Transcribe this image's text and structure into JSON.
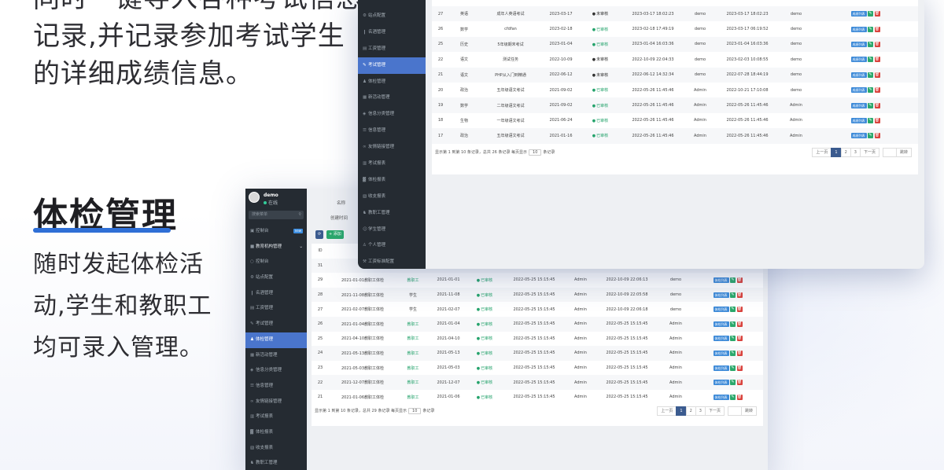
{
  "marketing": {
    "top_lines": [
      "同时一键导入各种考试信息",
      "记录,并记录参加考试学生",
      "的详细成绩信息。"
    ],
    "section_title": "体检管理",
    "section_lines": [
      "随时发起体检活",
      "动,学生和教职工",
      "均可录入管理。"
    ]
  },
  "accent_color": "#2f6fd6",
  "back_window": {
    "user": {
      "name": "demo",
      "status": "在线"
    },
    "search_placeholder": "搜索菜单",
    "nav": [
      {
        "label": "控制台",
        "icon": "dashboard-icon",
        "badge": "new",
        "group": false,
        "active": false
      },
      {
        "label": "教育机构管理",
        "icon": "folder-icon",
        "group": true,
        "active": false
      },
      {
        "label": "控制台",
        "icon": "circle-icon",
        "active": false
      },
      {
        "label": "站点配置",
        "icon": "gear-icon",
        "active": false
      },
      {
        "label": "名酒管理",
        "icon": "bottle-icon",
        "active": false
      },
      {
        "label": "工资管理",
        "icon": "doc-icon",
        "active": false
      },
      {
        "label": "考试管理",
        "icon": "edit-icon",
        "active": false
      },
      {
        "label": "体检管理",
        "icon": "user-icon",
        "active": true
      },
      {
        "label": "新活动管理",
        "icon": "grid-icon",
        "active": false
      },
      {
        "label": "信息分类管理",
        "icon": "tag-icon",
        "active": false
      },
      {
        "label": "信息管理",
        "icon": "list-icon",
        "active": false
      },
      {
        "label": "友情链接管理",
        "icon": "link-icon",
        "active": false
      },
      {
        "label": "考试报表",
        "icon": "table-icon",
        "active": false
      },
      {
        "label": "体检报表",
        "icon": "chart-icon",
        "active": false
      },
      {
        "label": "收支报表",
        "icon": "wallet-icon",
        "active": false
      },
      {
        "label": "教职工管理",
        "icon": "team-icon",
        "active": false
      }
    ],
    "filters": {
      "name_label": "名称",
      "created_label": "创建时间"
    },
    "toolbar": {
      "refresh": "⟳",
      "add": "+ 添加"
    },
    "header_id": "ID",
    "rows": [
      {
        "id": "31",
        "name": "",
        "type": "",
        "date": "",
        "status": "",
        "created": "",
        "creator": "",
        "updated": "",
        "editor": ""
      },
      {
        "id": "29",
        "name": "2021-01-01教职工体检",
        "type": "教职工",
        "type_teacher": true,
        "date": "2021-01-01",
        "status": "已审核",
        "created": "2022-05-25 15:15:45",
        "creator": "Admin",
        "updated": "2022-10-09 22:06:13",
        "editor": "demo"
      },
      {
        "id": "28",
        "name": "2021-11-08教职工体检",
        "type": "学生",
        "type_teacher": false,
        "date": "2021-11-08",
        "status": "已审核",
        "created": "2022-05-25 15:15:45",
        "creator": "Admin",
        "updated": "2022-10-09 22:05:58",
        "editor": "demo"
      },
      {
        "id": "27",
        "name": "2021-02-07教职工体检",
        "type": "学生",
        "type_teacher": false,
        "date": "2021-02-07",
        "status": "已审核",
        "created": "2022-05-25 15:15:45",
        "creator": "Admin",
        "updated": "2022-10-09 22:06:18",
        "editor": "demo"
      },
      {
        "id": "26",
        "name": "2021-01-04教职工体检",
        "type": "教职工",
        "type_teacher": true,
        "date": "2021-01-04",
        "status": "已审核",
        "created": "2022-05-25 15:15:45",
        "creator": "Admin",
        "updated": "2022-05-25 15:15:45",
        "editor": "Admin"
      },
      {
        "id": "25",
        "name": "2021-04-10教职工体检",
        "type": "教职工",
        "type_teacher": true,
        "date": "2021-04-10",
        "status": "已审核",
        "created": "2022-05-25 15:15:45",
        "creator": "Admin",
        "updated": "2022-05-25 15:15:45",
        "editor": "Admin"
      },
      {
        "id": "24",
        "name": "2021-05-13教职工体检",
        "type": "教职工",
        "type_teacher": true,
        "date": "2021-05-13",
        "status": "已审核",
        "created": "2022-05-25 15:15:45",
        "creator": "Admin",
        "updated": "2022-05-25 15:15:45",
        "editor": "Admin"
      },
      {
        "id": "23",
        "name": "2021-05-03教职工体检",
        "type": "教职工",
        "type_teacher": true,
        "date": "2021-05-03",
        "status": "已审核",
        "created": "2022-05-25 15:15:45",
        "creator": "Admin",
        "updated": "2022-05-25 15:15:45",
        "editor": "Admin"
      },
      {
        "id": "22",
        "name": "2021-12-07教职工体检",
        "type": "教职工",
        "type_teacher": true,
        "date": "2021-12-07",
        "status": "已审核",
        "created": "2022-05-25 15:15:45",
        "creator": "Admin",
        "updated": "2022-05-25 15:15:45",
        "editor": "Admin"
      },
      {
        "id": "21",
        "name": "2021-01-06教职工体检",
        "type": "教职工",
        "type_teacher": true,
        "date": "2021-01-06",
        "status": "已审核",
        "created": "2022-05-25 15:15:45",
        "creator": "Admin",
        "updated": "2022-05-25 15:15:45",
        "editor": "Admin"
      }
    ],
    "row_buttons": {
      "list": "体检列表",
      "edit": "✎",
      "del": "🗑"
    },
    "pager_info": {
      "prefix": "显示第 1 到第 10 条记录，总共 29 条记录 每页显示",
      "size": "10",
      "suffix": "条记录"
    },
    "pager": {
      "prev": "上一页",
      "pages": [
        "1",
        "2",
        "3"
      ],
      "next": "下一页",
      "jump": "跳转"
    }
  },
  "front_window": {
    "nav": [
      {
        "label": "站点配置",
        "icon": "gear-icon",
        "active": false
      },
      {
        "label": "名酒管理",
        "icon": "bottle-icon",
        "active": false
      },
      {
        "label": "工资管理",
        "icon": "doc-icon",
        "active": false
      },
      {
        "label": "考试管理",
        "icon": "edit-icon",
        "active": true
      },
      {
        "label": "体检管理",
        "icon": "user-icon",
        "active": false
      },
      {
        "label": "新活动管理",
        "icon": "grid-icon",
        "active": false
      },
      {
        "label": "信息分类管理",
        "icon": "tag-icon",
        "active": false
      },
      {
        "label": "信息管理",
        "icon": "list-icon",
        "active": false
      },
      {
        "label": "友情链接管理",
        "icon": "link-icon",
        "active": false
      },
      {
        "label": "考试报表",
        "icon": "table-icon",
        "active": false
      },
      {
        "label": "体检报表",
        "icon": "chart-icon",
        "active": false
      },
      {
        "label": "收支报表",
        "icon": "wallet-icon",
        "active": false
      },
      {
        "label": "教职工管理",
        "icon": "team-icon",
        "active": false
      },
      {
        "label": "学生管理",
        "icon": "student-icon",
        "active": false
      },
      {
        "label": "个人管理",
        "icon": "person-icon",
        "active": false
      },
      {
        "label": "工资标准配置",
        "icon": "settings-icon",
        "active": false
      }
    ],
    "rows": [
      {
        "id": "27",
        "subject": "英语",
        "name": "成年人英语考试",
        "date": "2023-03-17",
        "status": "未审核",
        "approved": false,
        "created": "2023-03-17 18:02:23",
        "creator": "demo",
        "updated": "2023-03-17 18:02:23",
        "editor": "demo"
      },
      {
        "id": "26",
        "subject": "数学",
        "name": "cfdfan",
        "date": "2023-02-18",
        "status": "已审核",
        "approved": true,
        "created": "2023-02-18 17:49:19",
        "creator": "demo",
        "updated": "2023-03-17 06:19:52",
        "editor": "demo"
      },
      {
        "id": "25",
        "subject": "历史",
        "name": "5年级期末考试",
        "date": "2023-01-04",
        "status": "已审核",
        "approved": true,
        "created": "2023-01-04 16:03:36",
        "creator": "demo",
        "updated": "2023-01-04 16:03:36",
        "editor": "demo"
      },
      {
        "id": "22",
        "subject": "语文",
        "name": "测试任务",
        "date": "2022-10-09",
        "status": "未审核",
        "approved": false,
        "created": "2022-10-09 22:04:33",
        "creator": "demo",
        "updated": "2023-02-03 10:08:55",
        "editor": "demo"
      },
      {
        "id": "21",
        "subject": "语文",
        "name": "PHP从入门到精通",
        "date": "2022-06-12",
        "status": "未审核",
        "approved": false,
        "created": "2022-06-12 14:32:34",
        "creator": "demo",
        "updated": "2022-07-28 18:44:19",
        "editor": "demo"
      },
      {
        "id": "20",
        "subject": "政治",
        "name": "五年级语文考试",
        "date": "2021-09-02",
        "status": "已审核",
        "approved": true,
        "created": "2022-05-26 11:45:46",
        "creator": "Admin",
        "updated": "2022-10-21 17:10:08",
        "editor": "demo"
      },
      {
        "id": "19",
        "subject": "数学",
        "name": "二年级语文考试",
        "date": "2021-09-02",
        "status": "已审核",
        "approved": true,
        "created": "2022-05-26 11:45:46",
        "creator": "Admin",
        "updated": "2022-05-26 11:45:46",
        "editor": "Admin"
      },
      {
        "id": "18",
        "subject": "生物",
        "name": "一年级语文考试",
        "date": "2021-06-24",
        "status": "已审核",
        "approved": true,
        "created": "2022-05-26 11:45:46",
        "creator": "Admin",
        "updated": "2022-05-26 11:45:46",
        "editor": "Admin"
      },
      {
        "id": "17",
        "subject": "政治",
        "name": "五年级语文考试",
        "date": "2021-01-16",
        "status": "已审核",
        "approved": true,
        "created": "2022-05-26 11:45:46",
        "creator": "Admin",
        "updated": "2022-05-26 11:45:46",
        "editor": "Admin"
      }
    ],
    "row_buttons": {
      "list": "成绩列表",
      "edit": "✎",
      "del": "🗑"
    },
    "pager_info": {
      "prefix": "显示第 1 到第 10 条记录，总共 26 条记录 每页显示",
      "size": "10",
      "suffix": "条记录"
    },
    "pager": {
      "prev": "上一页",
      "pages": [
        "1",
        "2",
        "3"
      ],
      "next": "下一页",
      "jump": "跳转"
    }
  }
}
